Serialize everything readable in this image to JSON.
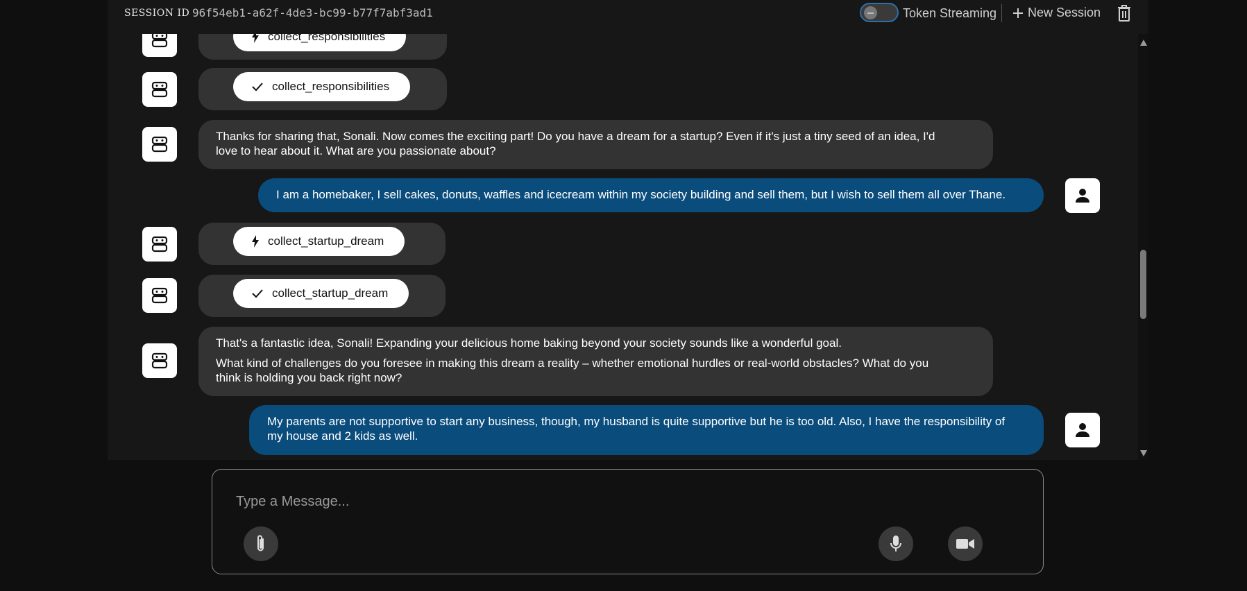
{
  "header": {
    "session_label": "SESSION ID",
    "session_id": "96f54eb1-a62f-4de3-bc99-b77f7abf3ad1",
    "token_streaming_label": "Token Streaming",
    "token_streaming_enabled": false,
    "new_session_label": "New Session"
  },
  "messages": [
    {
      "role": "tool-call",
      "tool": "collect_responsibilities",
      "icon": "bolt-icon"
    },
    {
      "role": "tool-result",
      "tool": "collect_responsibilities",
      "icon": "check-icon"
    },
    {
      "role": "assistant",
      "lines": [
        "Thanks for sharing that, Sonali. Now comes the exciting part! Do you have a dream for a startup? Even if it's just a tiny seed of an idea, I'd",
        "love to hear about it. What are you passionate about?"
      ]
    },
    {
      "role": "user",
      "lines": [
        "I am a homebaker, I sell cakes, donuts, waffles and icecream within my society building and sell them, but I wish to sell them all over Thane."
      ]
    },
    {
      "role": "tool-call",
      "tool": "collect_startup_dream",
      "icon": "bolt-icon"
    },
    {
      "role": "tool-result",
      "tool": "collect_startup_dream",
      "icon": "check-icon"
    },
    {
      "role": "assistant",
      "lines": [
        "That's a fantastic idea, Sonali! Expanding your delicious home baking beyond your society sounds like a wonderful goal.",
        "What kind of challenges do you foresee in making this dream a reality – whether emotional hurdles or real-world obstacles? What do you",
        "think is holding you back right now?"
      ]
    },
    {
      "role": "user",
      "lines": [
        "My parents are not supportive to start any business, though, my husband is quite supportive but he is too old. Also, I have the responsibility of",
        "my house and 2 kids as well."
      ]
    }
  ],
  "composer": {
    "placeholder": "Type a Message..."
  },
  "colors": {
    "user_bubble": "#0a4c7c",
    "assistant_bubble": "#333333",
    "toggle_border": "#2f6fa8"
  }
}
